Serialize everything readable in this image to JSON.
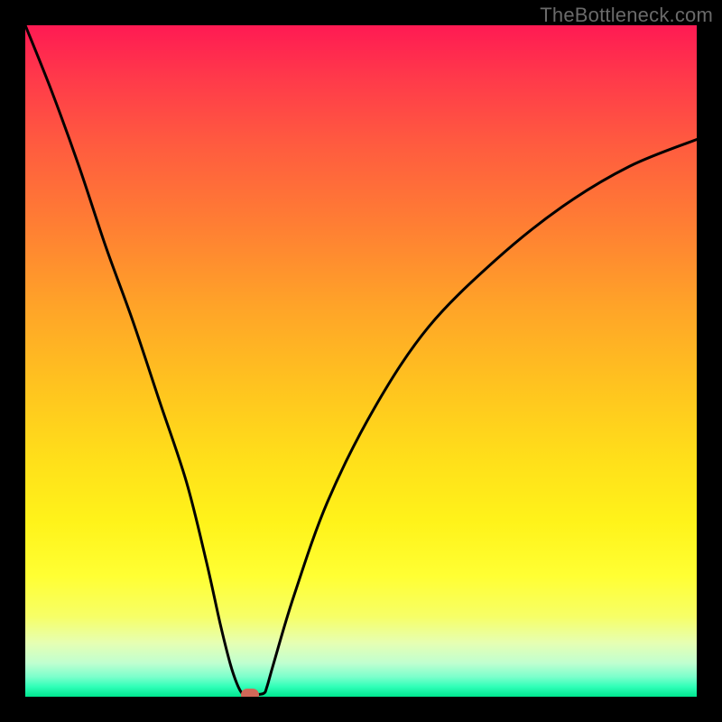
{
  "watermark": "TheBottleneck.com",
  "chart_data": {
    "type": "line",
    "title": "",
    "xlabel": "",
    "ylabel": "",
    "xlim": [
      0,
      100
    ],
    "ylim": [
      0,
      100
    ],
    "grid": false,
    "legend": false,
    "background_gradient": {
      "direction": "vertical",
      "stops": [
        {
          "pos": 0,
          "color": "#ff1a53"
        },
        {
          "pos": 30,
          "color": "#ff7f33"
        },
        {
          "pos": 65,
          "color": "#ffe01a"
        },
        {
          "pos": 90,
          "color": "#f0ff80"
        },
        {
          "pos": 100,
          "color": "#00e68f"
        }
      ]
    },
    "series": [
      {
        "name": "bottleneck-curve",
        "color": "#000000",
        "x": [
          0,
          4,
          8,
          12,
          16,
          20,
          24,
          27,
          29,
          30.5,
          31.5,
          32.3,
          33.0,
          34.0,
          35.5,
          36.0,
          37.0,
          40,
          45,
          52,
          60,
          70,
          80,
          90,
          100
        ],
        "y": [
          100,
          90,
          79,
          67,
          56,
          44,
          32,
          20,
          11,
          5,
          2,
          0.5,
          0.3,
          0.3,
          0.5,
          1.5,
          5,
          15,
          29,
          43,
          55,
          65,
          73,
          79,
          83
        ]
      }
    ],
    "marker": {
      "name": "optimal-point",
      "x": 33.5,
      "y": 0.3,
      "color": "#d06858"
    }
  }
}
